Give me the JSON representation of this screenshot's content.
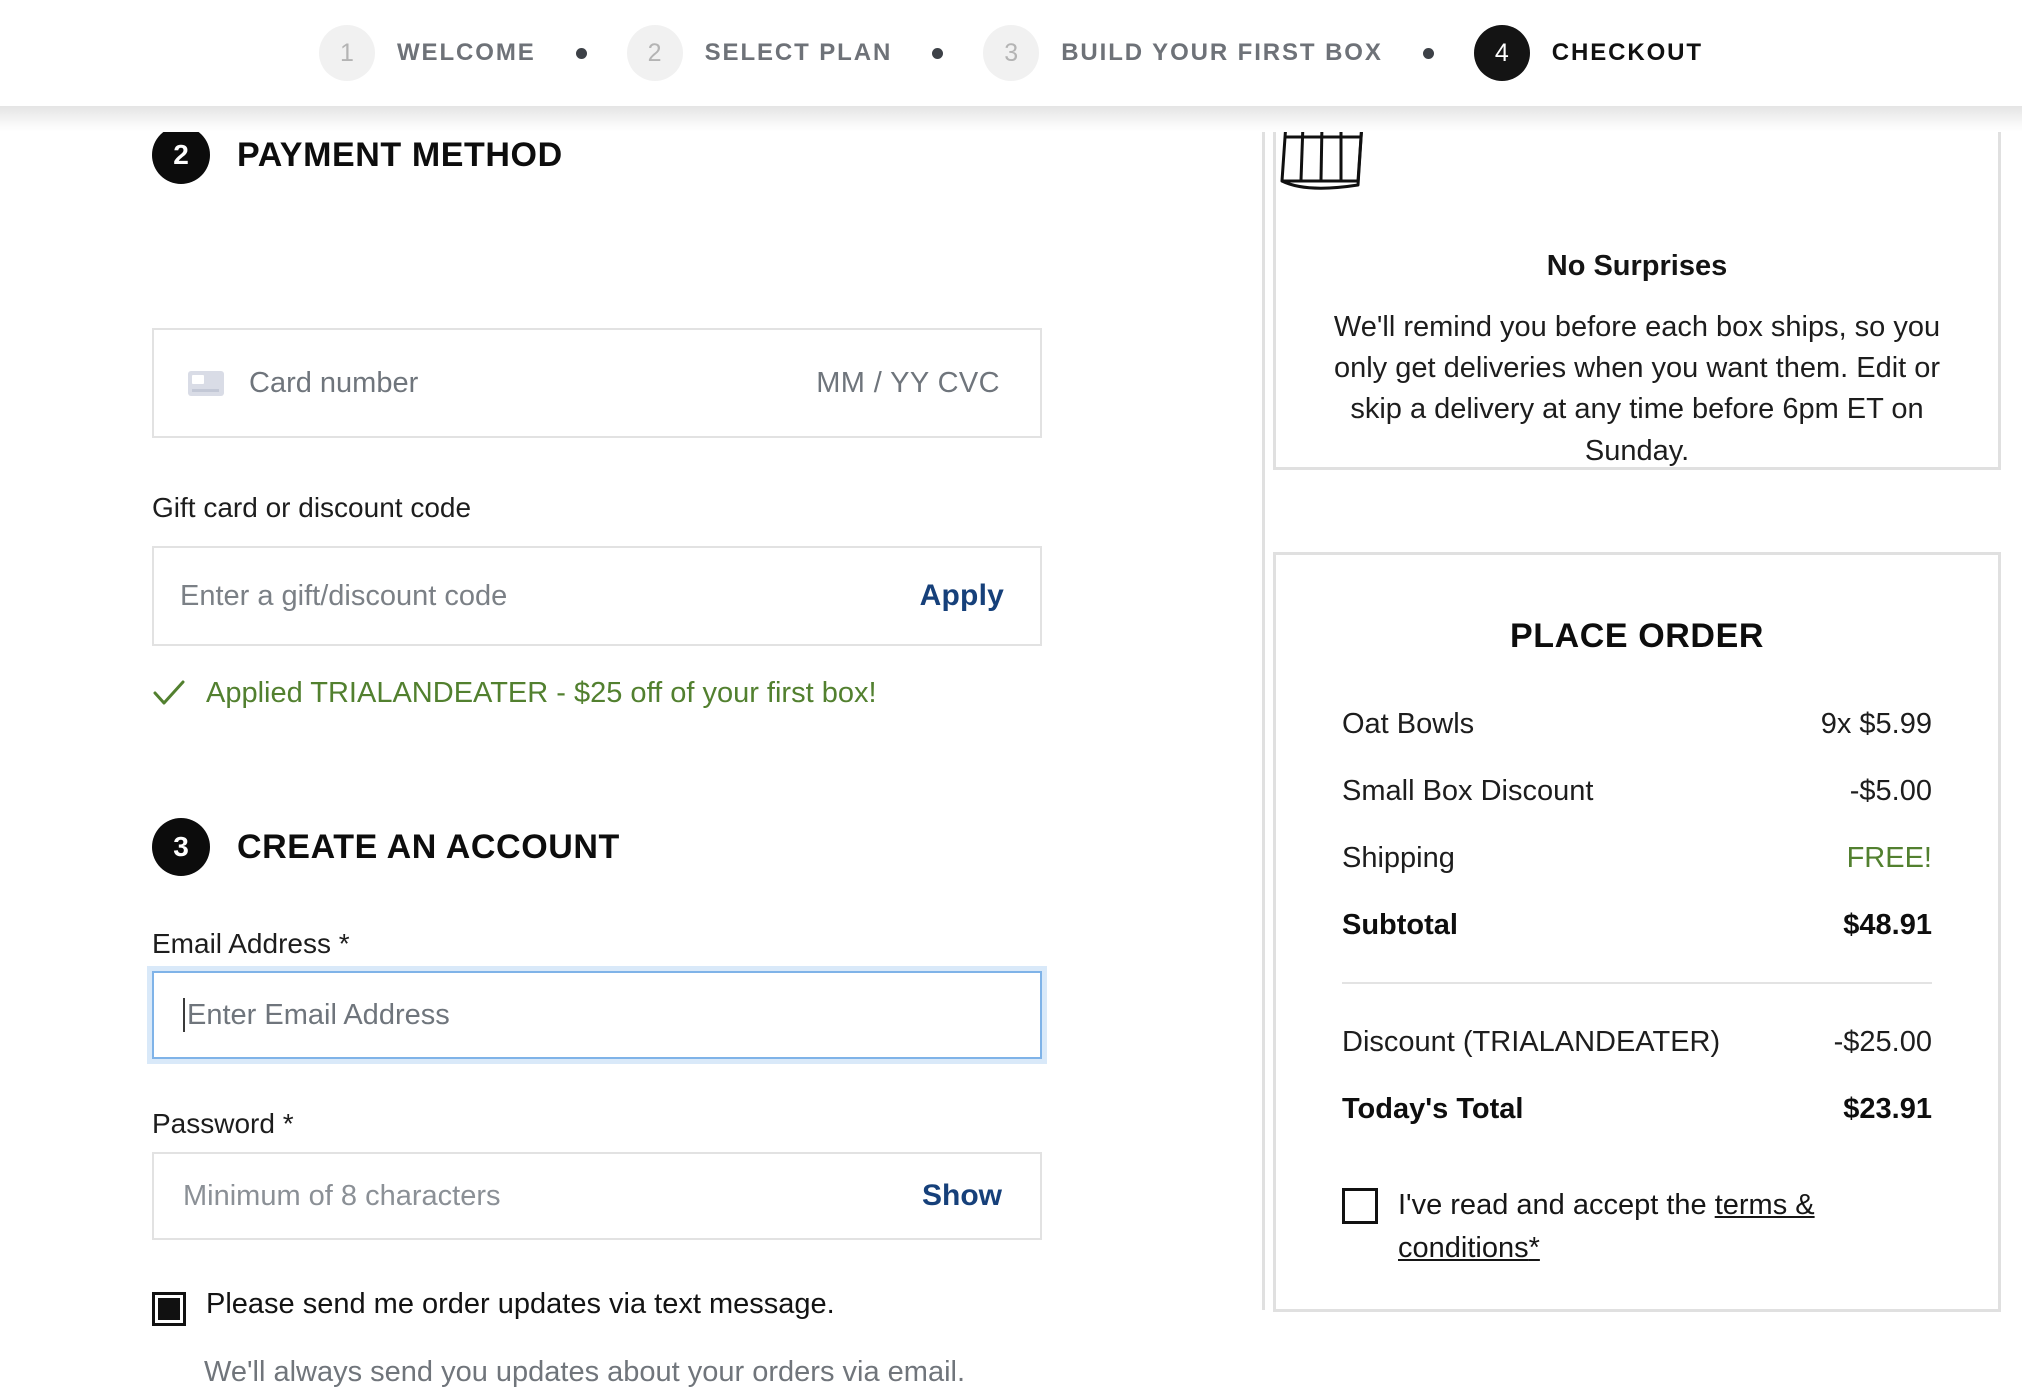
{
  "progress": {
    "steps": [
      {
        "number": "1",
        "label": "WELCOME",
        "active": false
      },
      {
        "number": "2",
        "label": "SELECT PLAN",
        "active": false
      },
      {
        "number": "3",
        "label": "BUILD YOUR FIRST BOX",
        "active": false
      },
      {
        "number": "4",
        "label": "CHECKOUT",
        "active": true
      }
    ]
  },
  "payment": {
    "step_number": "2",
    "title": "PAYMENT METHOD",
    "card_placeholder": "Card number",
    "card_expiry_cvc": "MM / YY  CVC",
    "gift_label": "Gift card or discount code",
    "gift_placeholder": "Enter a gift/discount code",
    "apply_label": "Apply",
    "applied_message": "Applied TRIALANDEATER - $25 off of your first box!"
  },
  "account": {
    "step_number": "3",
    "title": "CREATE AN ACCOUNT",
    "email_label": "Email Address *",
    "email_placeholder": "Enter Email Address",
    "email_value": "",
    "password_label": "Password *",
    "password_placeholder": "Minimum of 8 characters",
    "password_value": "",
    "show_label": "Show",
    "sms_label": "Please send me order updates via text message.",
    "sms_checked": true,
    "sms_note": "We'll always send you updates about your orders via email."
  },
  "no_surprises": {
    "title": "No Surprises",
    "body": "We'll remind you before each box ships, so you only get deliveries when you want them. Edit or skip a delivery at any time before 6pm ET on Sunday."
  },
  "place_order": {
    "title": "PLACE ORDER",
    "lines": [
      {
        "label": "Oat Bowls",
        "value": "9x $5.99",
        "bold": false,
        "green": false
      },
      {
        "label": "Small Box Discount",
        "value": "-$5.00",
        "bold": false,
        "green": false
      },
      {
        "label": "Shipping",
        "value": "FREE!",
        "bold": false,
        "green": true
      },
      {
        "label": "Subtotal",
        "value": "$48.91",
        "bold": true,
        "green": false
      }
    ],
    "lines_after": [
      {
        "label": "Discount (TRIALANDEATER)",
        "value": "-$25.00",
        "bold": false,
        "green": false
      },
      {
        "label": "Today's Total",
        "value": "$23.91",
        "bold": true,
        "green": false
      }
    ],
    "terms_checked": false,
    "terms_prefix": "I've read and accept the ",
    "terms_link": "terms & conditions",
    "terms_suffix": "*"
  },
  "colors": {
    "accent_link": "#16407a",
    "success_green": "#52802f",
    "active_step": "#141414",
    "border": "#e0e0e0",
    "focus_ring": "#7fb3e8"
  }
}
